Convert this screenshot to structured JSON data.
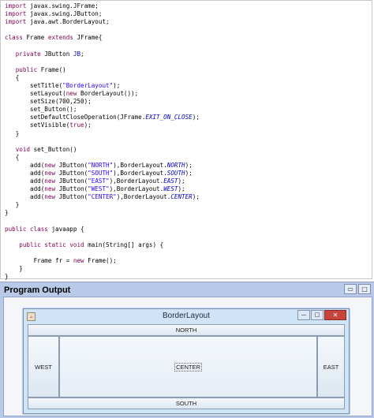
{
  "code_lines": [
    [
      {
        "t": "import ",
        "c": "kw"
      },
      {
        "t": "javax.swing.JFrame;",
        "c": "op"
      }
    ],
    [
      {
        "t": "import ",
        "c": "kw"
      },
      {
        "t": "javax.swing.JButton;",
        "c": "op"
      }
    ],
    [
      {
        "t": "import ",
        "c": "kw"
      },
      {
        "t": "java.awt.BorderLayout;",
        "c": "op"
      }
    ],
    [],
    [
      {
        "t": "class ",
        "c": "kw"
      },
      {
        "t": "Frame ",
        "c": "op"
      },
      {
        "t": "extends ",
        "c": "kw"
      },
      {
        "t": "JFrame{",
        "c": "op"
      }
    ],
    [],
    [
      {
        "t": "   private ",
        "c": "kw"
      },
      {
        "t": "JButton ",
        "c": "op"
      },
      {
        "t": "JB",
        "c": "fd"
      },
      {
        "t": ";",
        "c": "op"
      }
    ],
    [],
    [
      {
        "t": "   public ",
        "c": "kw"
      },
      {
        "t": "Frame()",
        "c": "op"
      }
    ],
    [
      {
        "t": "   {",
        "c": "op"
      }
    ],
    [
      {
        "t": "       setTitle(",
        "c": "op"
      },
      {
        "t": "\"BorderLayout\"",
        "c": "st"
      },
      {
        "t": ");",
        "c": "op"
      }
    ],
    [
      {
        "t": "       setLayout(",
        "c": "op"
      },
      {
        "t": "new ",
        "c": "kw"
      },
      {
        "t": "BorderLayout());",
        "c": "op"
      }
    ],
    [
      {
        "t": "       setSize(700,250);",
        "c": "op"
      }
    ],
    [
      {
        "t": "       set_Button();",
        "c": "op"
      }
    ],
    [
      {
        "t": "       setDefaultCloseOperation(JFrame.",
        "c": "op"
      },
      {
        "t": "EXIT_ON_CLOSE",
        "c": "cn"
      },
      {
        "t": ");",
        "c": "op"
      }
    ],
    [
      {
        "t": "       setVisible(",
        "c": "op"
      },
      {
        "t": "true",
        "c": "kw"
      },
      {
        "t": ");",
        "c": "op"
      }
    ],
    [
      {
        "t": "   }",
        "c": "op"
      }
    ],
    [],
    [
      {
        "t": "   void ",
        "c": "kw"
      },
      {
        "t": "set_Button()",
        "c": "op"
      }
    ],
    [
      {
        "t": "   {",
        "c": "op"
      }
    ],
    [
      {
        "t": "       add(",
        "c": "op"
      },
      {
        "t": "new ",
        "c": "kw"
      },
      {
        "t": "JButton(",
        "c": "op"
      },
      {
        "t": "\"NORTH\"",
        "c": "st"
      },
      {
        "t": "),BorderLayout.",
        "c": "op"
      },
      {
        "t": "NORTH",
        "c": "cn"
      },
      {
        "t": ");",
        "c": "op"
      }
    ],
    [
      {
        "t": "       add(",
        "c": "op"
      },
      {
        "t": "new ",
        "c": "kw"
      },
      {
        "t": "JButton(",
        "c": "op"
      },
      {
        "t": "\"SOUTH\"",
        "c": "st"
      },
      {
        "t": "),BorderLayout.",
        "c": "op"
      },
      {
        "t": "SOUTH",
        "c": "cn"
      },
      {
        "t": ");",
        "c": "op"
      }
    ],
    [
      {
        "t": "       add(",
        "c": "op"
      },
      {
        "t": "new ",
        "c": "kw"
      },
      {
        "t": "JButton(",
        "c": "op"
      },
      {
        "t": "\"EAST\"",
        "c": "st"
      },
      {
        "t": "),BorderLayout.",
        "c": "op"
      },
      {
        "t": "EAST",
        "c": "cn"
      },
      {
        "t": ");",
        "c": "op"
      }
    ],
    [
      {
        "t": "       add(",
        "c": "op"
      },
      {
        "t": "new ",
        "c": "kw"
      },
      {
        "t": "JButton(",
        "c": "op"
      },
      {
        "t": "\"WEST\"",
        "c": "st"
      },
      {
        "t": "),BorderLayout.",
        "c": "op"
      },
      {
        "t": "WEST",
        "c": "cn"
      },
      {
        "t": ");",
        "c": "op"
      }
    ],
    [
      {
        "t": "       add(",
        "c": "op"
      },
      {
        "t": "new ",
        "c": "kw"
      },
      {
        "t": "JButton(",
        "c": "op"
      },
      {
        "t": "\"CENTER\"",
        "c": "st"
      },
      {
        "t": "),BorderLayout.",
        "c": "op"
      },
      {
        "t": "CENTER",
        "c": "cn"
      },
      {
        "t": ");",
        "c": "op"
      }
    ],
    [
      {
        "t": "   }",
        "c": "op"
      }
    ],
    [
      {
        "t": "}",
        "c": "op"
      }
    ],
    [],
    [
      {
        "t": "public ",
        "c": "kw"
      },
      {
        "t": "class ",
        "c": "kw"
      },
      {
        "t": "javaapp {",
        "c": "op"
      }
    ],
    [],
    [
      {
        "t": "    public ",
        "c": "kw"
      },
      {
        "t": "static ",
        "c": "kw"
      },
      {
        "t": "void ",
        "c": "kw"
      },
      {
        "t": "main(String[] args) {",
        "c": "op"
      }
    ],
    [],
    [
      {
        "t": "        Frame fr = ",
        "c": "op"
      },
      {
        "t": "new ",
        "c": "kw"
      },
      {
        "t": "Frame();",
        "c": "op"
      }
    ],
    [
      {
        "t": "    }",
        "c": "op"
      }
    ],
    [
      {
        "t": "}",
        "c": "op"
      }
    ]
  ],
  "output_panel": {
    "title": "Program Output",
    "controls": {
      "minimize": "▭",
      "maximize": "□",
      "close": "✕"
    }
  },
  "window": {
    "title": "BorderLayout",
    "icon": "java-cup-icon",
    "controls": {
      "minimize": "—",
      "maximize": "□",
      "close": "✕"
    },
    "buttons": {
      "north": "NORTH",
      "south": "SOUTH",
      "east": "EAST",
      "west": "WEST",
      "center": "CENTER"
    }
  }
}
